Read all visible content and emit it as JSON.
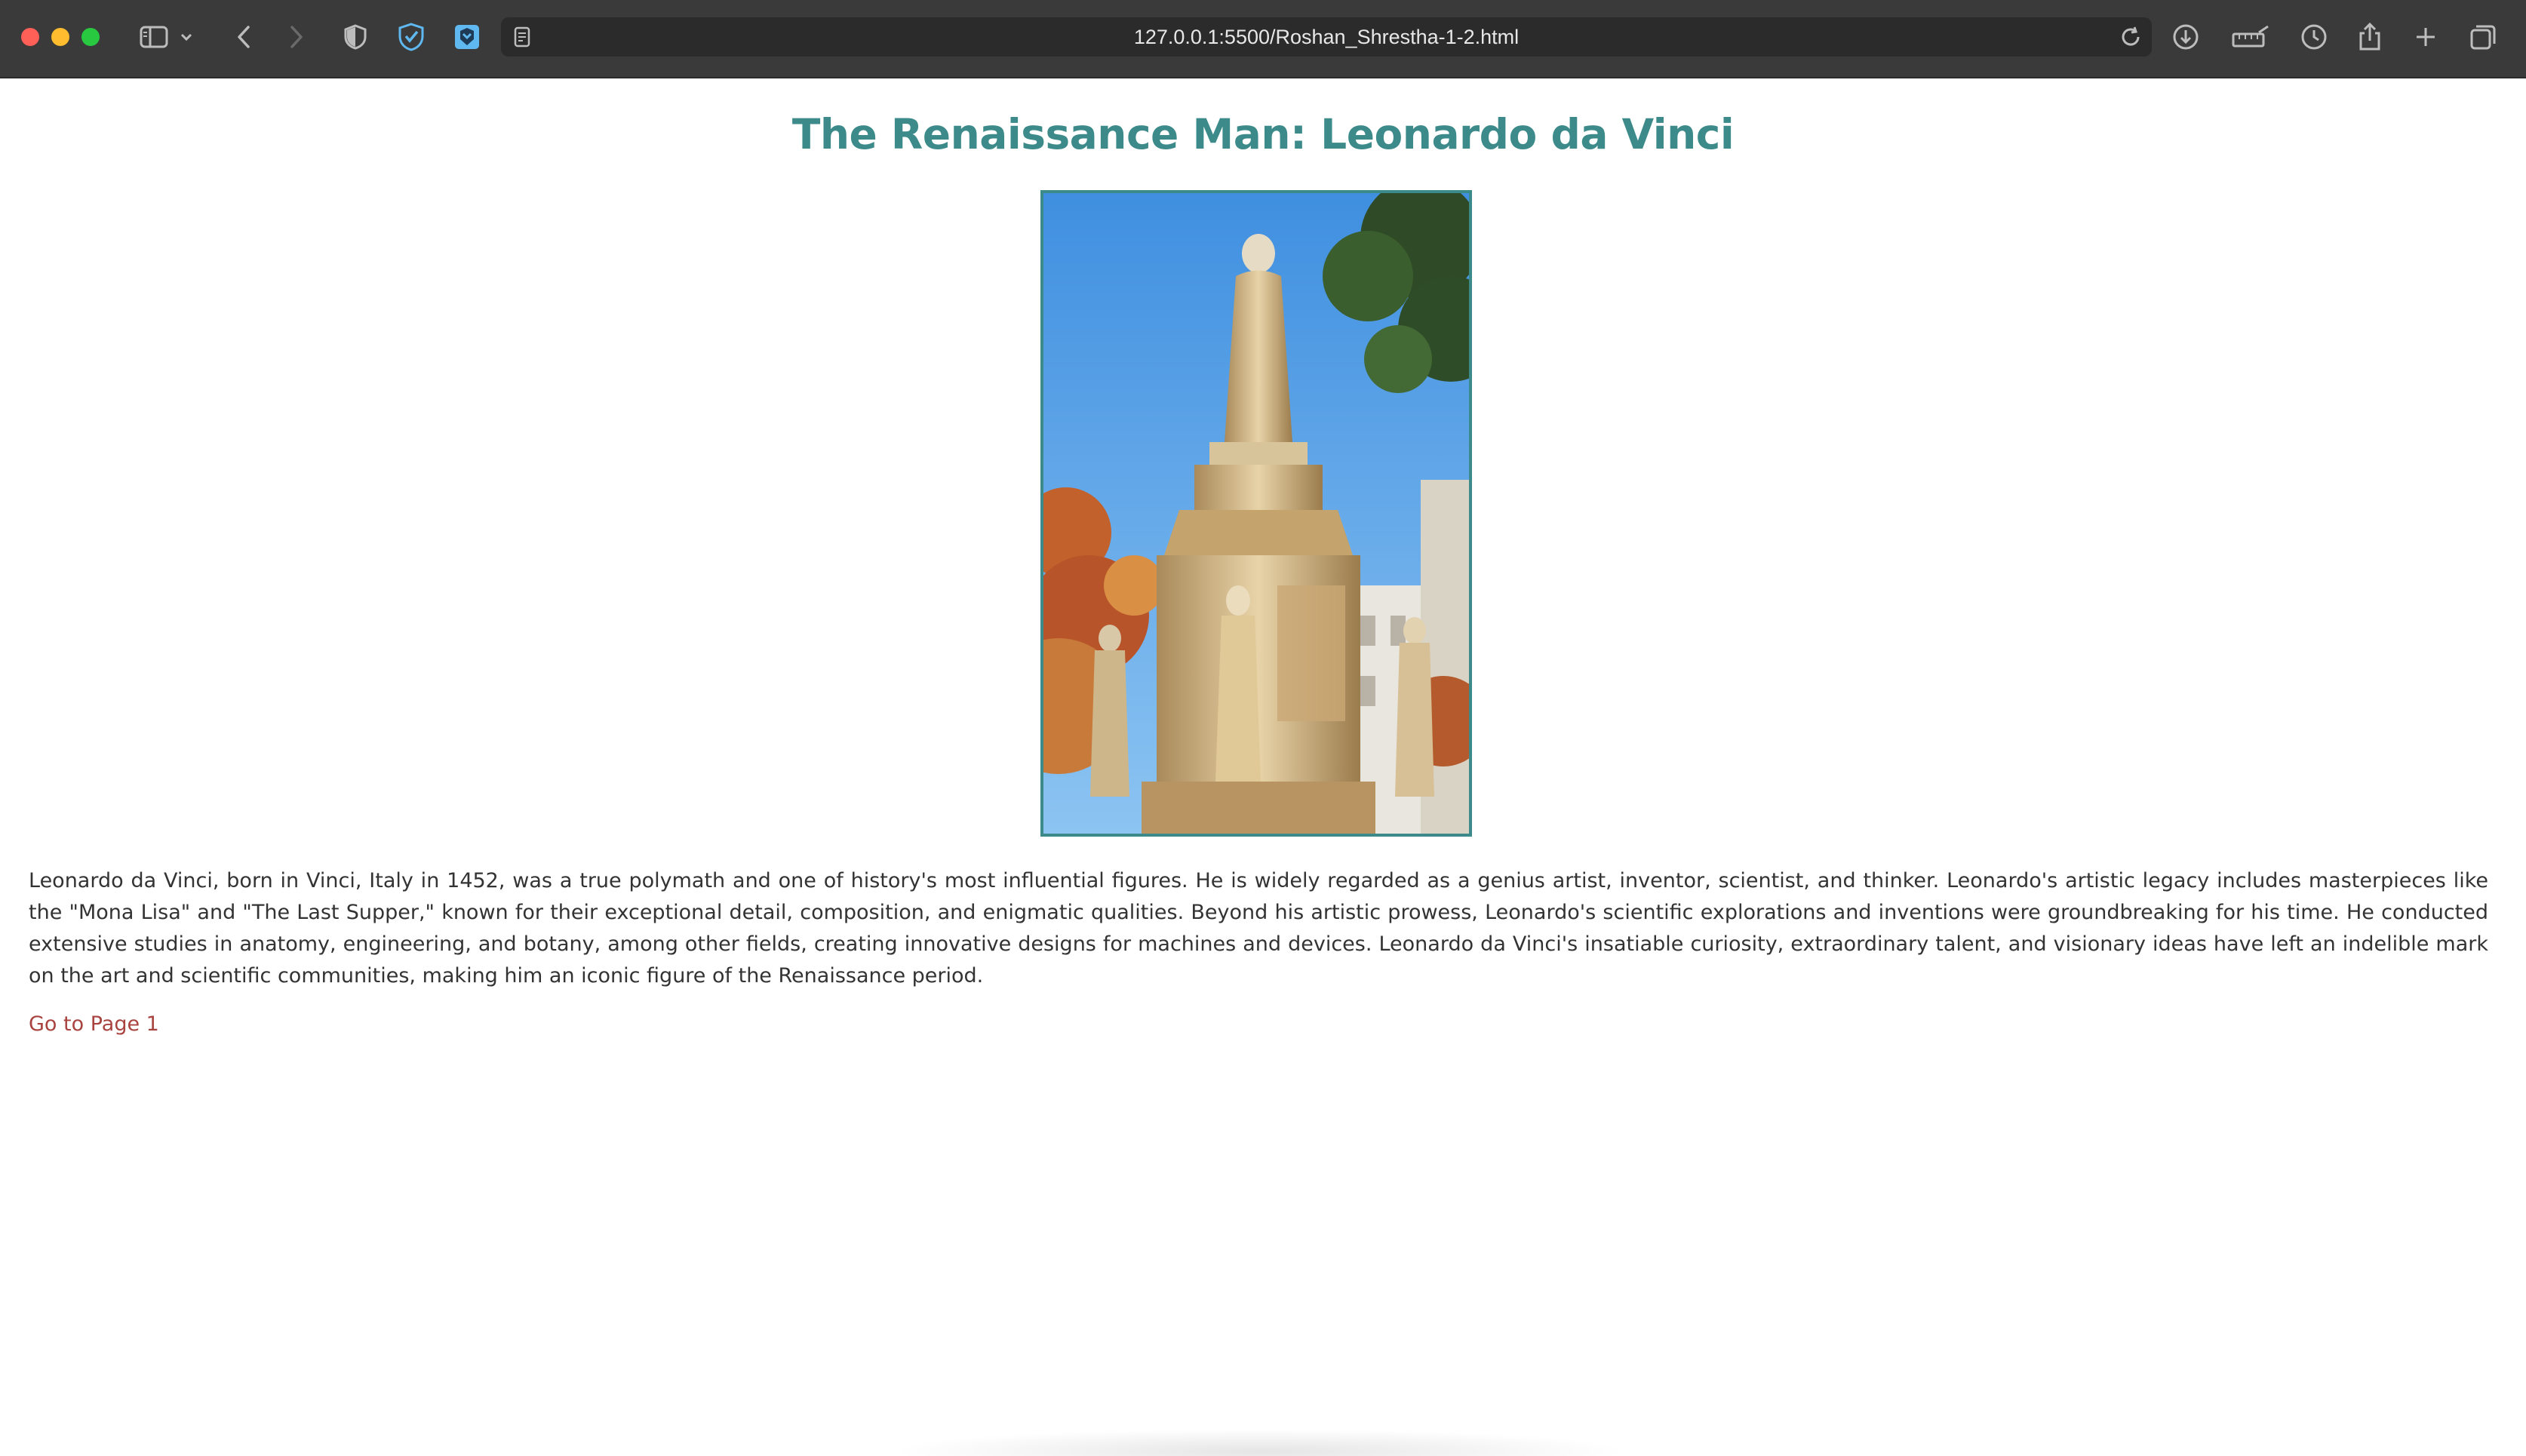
{
  "browser": {
    "url": "127.0.0.1:5500/Roshan_Shrestha-1-2.html",
    "icons": [
      "sidebar-icon",
      "chevron-down-icon",
      "back-icon",
      "forward-icon",
      "privacy-shield-icon",
      "adguard-icon",
      "extension-icon",
      "page-icon",
      "reload-icon",
      "download-icon",
      "ruler-icon",
      "history-icon",
      "share-icon",
      "new-tab-icon",
      "tabs-overview-icon"
    ]
  },
  "page": {
    "title": "The Renaissance Man: Leonardo da Vinci",
    "description": "Leonardo da Vinci, born in Vinci, Italy in 1452, was a true polymath and one of history's most influential figures. He is widely regarded as a genius artist, inventor, scientist, and thinker. Leonardo's artistic legacy includes masterpieces like the \"Mona Lisa\" and \"The Last Supper,\" known for their exceptional detail, composition, and enigmatic qualities. Beyond his artistic prowess, Leonardo's scientific explorations and inventions were groundbreaking for his time. He conducted extensive studies in anatomy, engineering, and botany, among other fields, creating innovative designs for machines and devices. Leonardo da Vinci's insatiable curiosity, extraordinary talent, and visionary ideas have left an indelible mark on the art and scientific communities, making him an iconic figure of the Renaissance period.",
    "link_label": "Go to Page 1"
  },
  "colors": {
    "title": "#3d8a8a",
    "frame_border": "#3d8a8a",
    "link": "#a9433f",
    "body_text": "#333333",
    "toolbar": "#3a3a3a"
  }
}
